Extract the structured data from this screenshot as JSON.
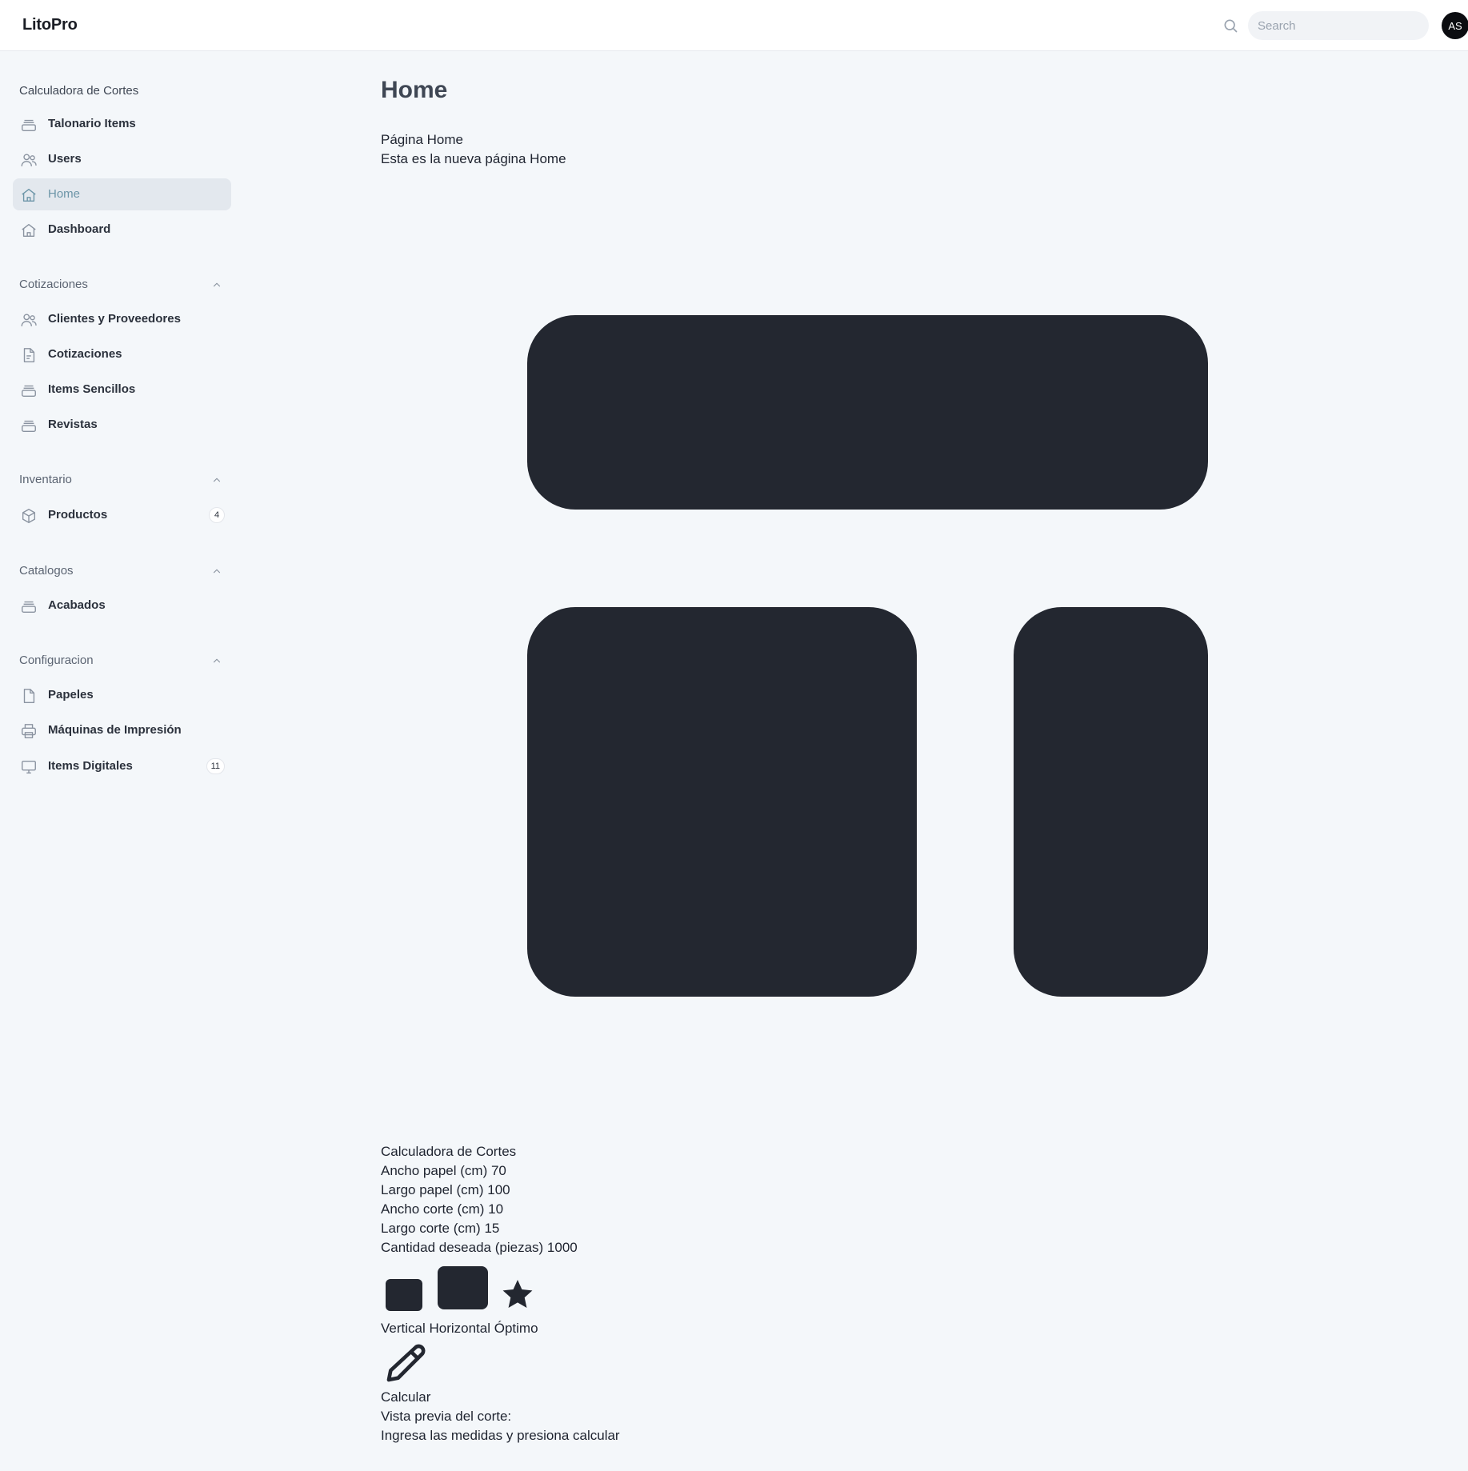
{
  "app": {
    "brand": "LitoPro",
    "search": {
      "placeholder": "Search",
      "value": ""
    },
    "user_initials": "AS"
  },
  "sidebar": {
    "sections": [
      {
        "label": "Calculadora de Cortes",
        "collapsible": false,
        "items": [
          {
            "label": "Talonario Items",
            "icon": "stack-icon",
            "active": false,
            "badge": null
          },
          {
            "label": "Users",
            "icon": "users-icon",
            "active": false,
            "badge": null
          },
          {
            "label": "Home",
            "icon": "home-icon",
            "active": true,
            "badge": null
          },
          {
            "label": "Dashboard",
            "icon": "home-icon",
            "active": false,
            "badge": null
          }
        ]
      },
      {
        "label": "Cotizaciones",
        "collapsible": true,
        "items": [
          {
            "label": "Clientes y Proveedores",
            "icon": "users-icon",
            "active": false,
            "badge": null
          },
          {
            "label": "Cotizaciones",
            "icon": "document-text-icon",
            "active": false,
            "badge": null
          },
          {
            "label": "Items Sencillos",
            "icon": "stack-icon",
            "active": false,
            "badge": null
          },
          {
            "label": "Revistas",
            "icon": "stack-icon",
            "active": false,
            "badge": null
          }
        ]
      },
      {
        "label": "Inventario",
        "collapsible": true,
        "items": [
          {
            "label": "Productos",
            "icon": "cube-icon",
            "active": false,
            "badge": "4"
          }
        ]
      },
      {
        "label": "Catalogos",
        "collapsible": true,
        "items": [
          {
            "label": "Acabados",
            "icon": "stack-icon",
            "active": false,
            "badge": null
          }
        ]
      },
      {
        "label": "Configuracion",
        "collapsible": true,
        "items": [
          {
            "label": "Papeles",
            "icon": "document-icon",
            "active": false,
            "badge": null
          },
          {
            "label": "Máquinas de Impresión",
            "icon": "printer-icon",
            "active": false,
            "badge": null
          },
          {
            "label": "Items Digitales",
            "icon": "monitor-icon",
            "active": false,
            "badge": "11"
          }
        ]
      }
    ]
  },
  "main": {
    "title": "Home",
    "intro_heading": "Página Home",
    "intro_text": "Esta es la nueva página Home",
    "calculator": {
      "heading": "Calculadora de Cortes",
      "fields": [
        {
          "label": "Ancho papel (cm)",
          "value": "70"
        },
        {
          "label": "Largo papel (cm)",
          "value": "100"
        },
        {
          "label": "Ancho corte (cm)",
          "value": "10"
        },
        {
          "label": "Largo corte (cm)",
          "value": "15"
        },
        {
          "label": "Cantidad deseada (piezas)",
          "value": "1000"
        }
      ],
      "orientation_labels": "Vertical Horizontal Óptimo",
      "calculate_label": "Calcular",
      "preview_label": "Vista previa del corte:",
      "preview_hint": "Ingresa las medidas y presiona calcular"
    }
  },
  "colors": {
    "background": "#f4f7fa",
    "block": "#232730",
    "active_item_bg": "#e3e8ee",
    "active_item_text": "#6c95a8"
  }
}
